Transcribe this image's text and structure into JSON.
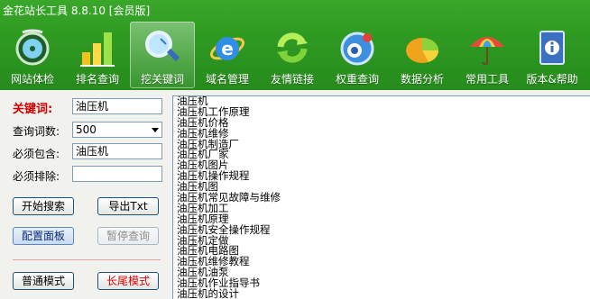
{
  "app": {
    "title": "金花站长工具 8.8.10 [会员版]"
  },
  "toolbar": [
    {
      "label": "网站体检",
      "icon": "stethoscope-icon",
      "active": false
    },
    {
      "label": "排名查询",
      "icon": "bar-chart-icon",
      "active": false
    },
    {
      "label": "挖关键词",
      "icon": "magnifier-icon",
      "active": true
    },
    {
      "label": "域名管理",
      "icon": "globe-e-icon",
      "active": false
    },
    {
      "label": "友情链接",
      "icon": "refresh-arrows-icon",
      "active": false
    },
    {
      "label": "权重查询",
      "icon": "gauge-icon",
      "active": false
    },
    {
      "label": "数据分析",
      "icon": "pie-chart-icon",
      "active": false
    },
    {
      "label": "常用工具",
      "icon": "umbrella-icon",
      "active": false
    },
    {
      "label": "版本&帮助",
      "icon": "book-info-icon",
      "active": false
    }
  ],
  "form": {
    "keyword_label": "关键词:",
    "keyword_value": "油压机",
    "count_label": "查询词数:",
    "count_value": "500",
    "include_label": "必须包含:",
    "include_value": "油压机",
    "exclude_label": "必须排除:",
    "exclude_value": ""
  },
  "buttons": {
    "start": "开始搜索",
    "export": "导出Txt",
    "config": "配置面板",
    "pause": "暂停查询",
    "normal_mode": "普通模式",
    "longtail_mode": "长尾模式"
  },
  "results": [
    "油压机",
    "油压机工作原理",
    "油压机价格",
    "油压机维修",
    "油压机制造厂",
    "油压机厂家",
    "油压机图片",
    "油压机操作规程",
    "油压机图",
    "油压机常见故障与维修",
    "油压机加工",
    "油压机原理",
    "油压机安全操作规程",
    "油压机定做",
    "油压机电路图",
    "油压机维修教程",
    "油压机油泵",
    "油压机作业指导书",
    "油压机的设计"
  ],
  "colors": {
    "header_green": "#2f9a22",
    "keyword_red": "#d00000"
  }
}
